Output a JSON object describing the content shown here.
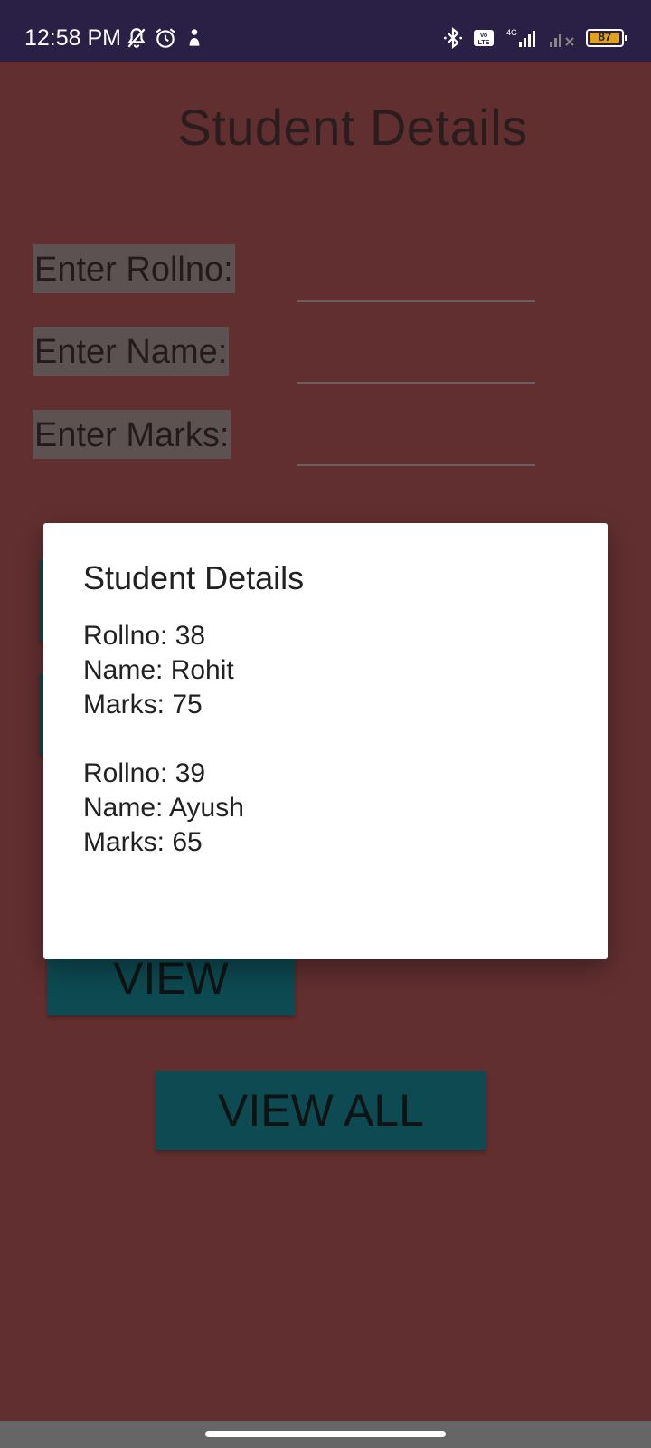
{
  "status_bar": {
    "time": "12:58 PM",
    "left_icons": [
      "bell-off-icon",
      "alarm-icon",
      "notification-icon"
    ],
    "right_icons": [
      "bluetooth-icon",
      "volte-icon",
      "signal-4g-icon",
      "signal-icon"
    ],
    "volte_label": "Vo LTE",
    "network_label": "4G",
    "battery_level": "87"
  },
  "page": {
    "title": "Student Details",
    "background_color": "#622f30"
  },
  "form": {
    "rollno_label": "Enter Rollno:",
    "name_label": "Enter Name:",
    "marks_label": "Enter Marks:",
    "rollno_value": "",
    "name_value": "",
    "marks_value": ""
  },
  "buttons": {
    "view_label": "VIEW",
    "view_all_label": "VIEW ALL",
    "color": "#0d4a51"
  },
  "dialog": {
    "title": "Student Details",
    "records": [
      {
        "rollno": "Rollno: 38",
        "name": "Name: Rohit",
        "marks": "Marks: 75"
      },
      {
        "rollno": "Rollno: 39",
        "name": "Name: Ayush",
        "marks": "Marks: 65"
      }
    ]
  }
}
